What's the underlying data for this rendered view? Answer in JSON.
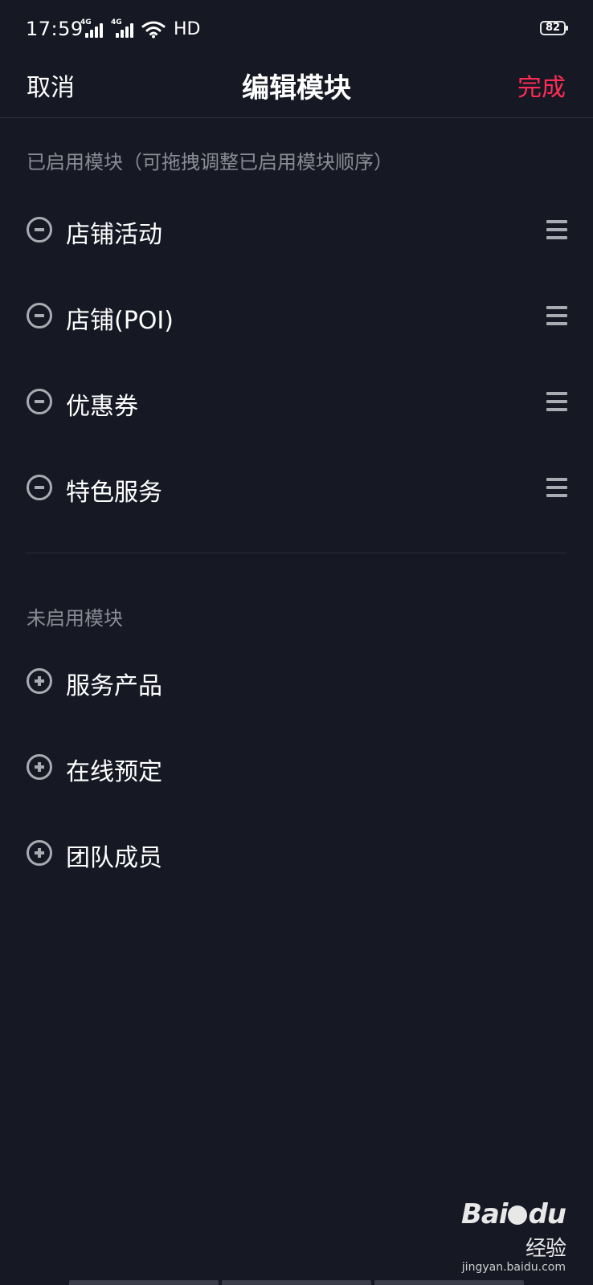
{
  "status_bar": {
    "time": "17:59",
    "network_1": "4G",
    "network_2": "4G",
    "hd": "HD",
    "battery": "82"
  },
  "header": {
    "cancel_label": "取消",
    "title": "编辑模块",
    "done_label": "完成",
    "done_color": "#fe2c55"
  },
  "enabled_section": {
    "title": "已启用模块（可拖拽调整已启用模块顺序）",
    "items": [
      {
        "label": "店铺活动",
        "icon": "minus-circle-icon",
        "handle": "drag-handle-icon"
      },
      {
        "label": "店铺(POI)",
        "icon": "minus-circle-icon",
        "handle": "drag-handle-icon"
      },
      {
        "label": "优惠券",
        "icon": "minus-circle-icon",
        "handle": "drag-handle-icon"
      },
      {
        "label": "特色服务",
        "icon": "minus-circle-icon",
        "handle": "drag-handle-icon"
      }
    ]
  },
  "disabled_section": {
    "title": "未启用模块",
    "items": [
      {
        "label": "服务产品",
        "icon": "plus-circle-icon"
      },
      {
        "label": "在线预定",
        "icon": "plus-circle-icon"
      },
      {
        "label": "团队成员",
        "icon": "plus-circle-icon"
      }
    ]
  },
  "watermark": {
    "logo_bai": "Bai",
    "logo_du": "du",
    "logo_jingyan": "经验",
    "url": "jingyan.baidu.com"
  }
}
